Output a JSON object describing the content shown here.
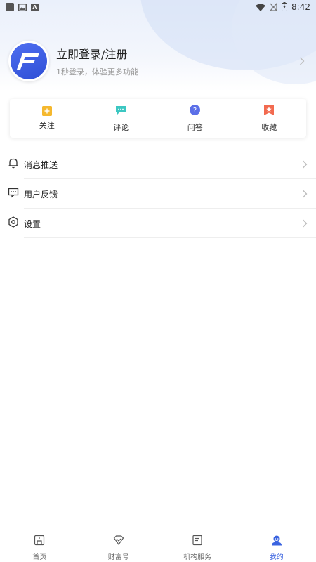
{
  "status_bar": {
    "time": "8:42",
    "notif_letter": "A"
  },
  "profile": {
    "title": "立即登录/注册",
    "subtitle": "1秒登录，体验更多功能",
    "avatar_letter": "F"
  },
  "actions": [
    {
      "label": "关注",
      "icon": "bookmark-plus-icon",
      "color": "#f5b82e"
    },
    {
      "label": "评论",
      "icon": "comment-icon",
      "color": "#3cc7c2"
    },
    {
      "label": "问答",
      "icon": "question-icon",
      "color": "#5b6fe8"
    },
    {
      "label": "收藏",
      "icon": "star-bookmark-icon",
      "color": "#f26a4f"
    }
  ],
  "menu": [
    {
      "label": "消息推送",
      "icon": "bell-icon"
    },
    {
      "label": "用户反馈",
      "icon": "feedback-icon"
    },
    {
      "label": "设置",
      "icon": "settings-icon"
    }
  ],
  "bottom_nav": [
    {
      "label": "首页",
      "icon": "home-icon",
      "active": false
    },
    {
      "label": "财富号",
      "icon": "diamond-icon",
      "active": false
    },
    {
      "label": "机构服务",
      "icon": "document-icon",
      "active": false
    },
    {
      "label": "我的",
      "icon": "user-icon",
      "active": true
    }
  ],
  "colors": {
    "accent": "#3a63e0",
    "divider": "#eeeeee"
  }
}
